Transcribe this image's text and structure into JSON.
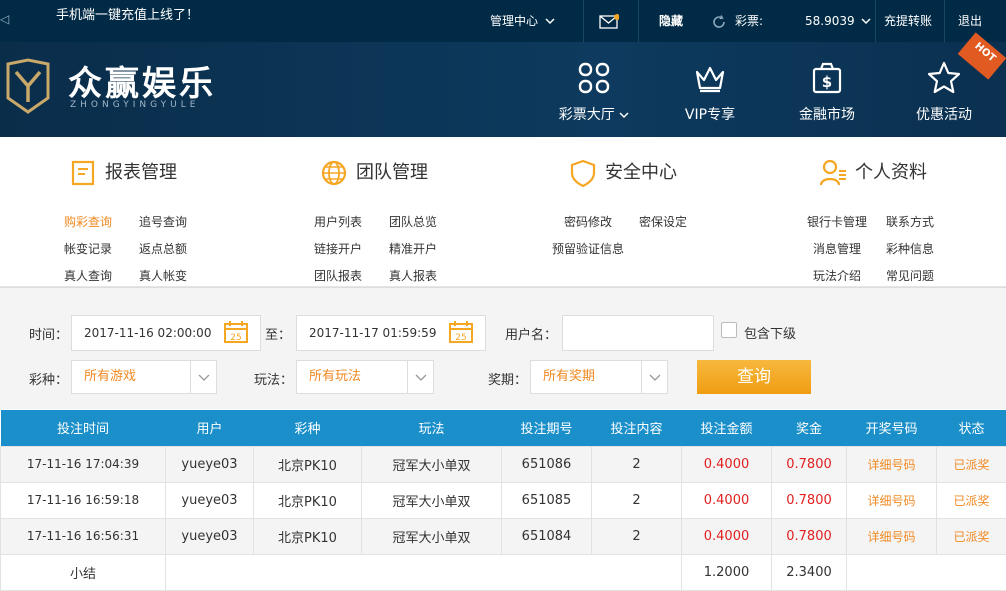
{
  "topbar": {
    "notice": "手机端一键充值上线了！",
    "admin_center": "管理中心",
    "hide": "隐藏",
    "lottery_label": "彩票:",
    "balance": "58.9039",
    "recharge_transfer": "充提转账",
    "logout": "退出"
  },
  "header": {
    "logo_text": "众赢娱乐",
    "logo_sub": "ZHONGYINGYULE",
    "nav": [
      {
        "label": "彩票大厅",
        "icon": "grid-icon"
      },
      {
        "label": "VIP专享",
        "icon": "crown-icon"
      },
      {
        "label": "金融市场",
        "icon": "dollar-bag-icon"
      },
      {
        "label": "优惠活动",
        "icon": "star-icon"
      }
    ],
    "hot_badge": "HOT"
  },
  "menu": {
    "groups": [
      {
        "title": "报表管理",
        "links": [
          "购彩查询",
          "追号查询",
          "帐变记录",
          "返点总额",
          "真人查询",
          "真人帐变"
        ]
      },
      {
        "title": "团队管理",
        "links": [
          "用户列表",
          "团队总览",
          "链接开户",
          "精准开户",
          "团队报表",
          "真人报表"
        ]
      },
      {
        "title": "安全中心",
        "links": [
          "密码修改",
          "密保设定",
          "预留验证信息"
        ]
      },
      {
        "title": "个人资料",
        "links": [
          "银行卡管理",
          "联系方式",
          "消息管理",
          "彩种信息",
          "玩法介绍",
          "常见问题"
        ]
      }
    ]
  },
  "filter": {
    "time_label": "时间：",
    "start_time": "2017-11-16 02:00:00",
    "to_label": "至：",
    "end_time": "2017-11-17 01:59:59",
    "username_label": "用户名：",
    "username_value": "",
    "include_sub_label": "包含下级",
    "lottery_type_label": "彩种：",
    "lottery_type_value": "所有游戏",
    "play_label": "玩法：",
    "play_value": "所有玩法",
    "period_label": "奖期：",
    "period_value": "所有奖期",
    "query_button": "查询"
  },
  "table": {
    "headers": [
      "投注时间",
      "用户",
      "彩种",
      "玩法",
      "投注期号",
      "投注内容",
      "投注金额",
      "奖金",
      "开奖号码",
      "状态"
    ],
    "rows": [
      [
        "17-11-16 17:04:39",
        "yueye03",
        "北京PK10",
        "冠军大小单双",
        "651086",
        "2",
        "0.4000",
        "0.7800",
        "详细号码",
        "已派奖"
      ],
      [
        "17-11-16 16:59:18",
        "yueye03",
        "北京PK10",
        "冠军大小单双",
        "651085",
        "2",
        "0.4000",
        "0.7800",
        "详细号码",
        "已派奖"
      ],
      [
        "17-11-16 16:56:31",
        "yueye03",
        "北京PK10",
        "冠军大小单双",
        "651084",
        "2",
        "0.4000",
        "0.7800",
        "详细号码",
        "已派奖"
      ]
    ],
    "subtotal_label": "小结",
    "subtotal_amount": "1.2000",
    "subtotal_bonus": "2.3400"
  },
  "colors": {
    "topbar_bg": "#002a45",
    "accent_orange": "#f08a23",
    "table_header": "#1a8fc9",
    "amount_red": "#e02020"
  }
}
